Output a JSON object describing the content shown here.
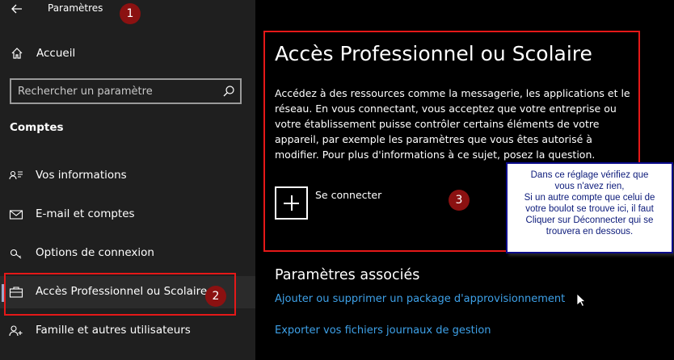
{
  "window": {
    "title": "Paramètres",
    "back_icon": "arrow-left-icon"
  },
  "sidebar": {
    "home_label": "Accueil",
    "search_placeholder": "Rechercher un paramètre",
    "section_title": "Comptes",
    "items": [
      {
        "label": "Vos informations",
        "icon": "person-card-icon"
      },
      {
        "label": "E-mail et comptes",
        "icon": "mail-icon"
      },
      {
        "label": "Options de connexion",
        "icon": "key-icon"
      },
      {
        "label": "Accès Professionnel ou Scolaire",
        "icon": "briefcase-icon",
        "selected": true
      },
      {
        "label": "Famille et autres utilisateurs",
        "icon": "person-add-icon"
      }
    ]
  },
  "main": {
    "title": "Accès Professionnel ou Scolaire",
    "description": "Accédez à des ressources comme la messagerie, les applications et le réseau. En vous connectant, vous acceptez que votre entreprise ou votre établissement puisse contrôler certains éléments de votre appareil, par exemple les paramètres que vous êtes autorisé à modifier. Pour plus d'informations à ce sujet, posez la question.",
    "connect_label": "Se connecter",
    "related_title": "Paramètres associés",
    "links": [
      "Ajouter ou supprimer un package d'approvisionnement",
      "Exporter vos fichiers journaux de gestion"
    ]
  },
  "annotations": {
    "markers": [
      "1",
      "2",
      "3"
    ],
    "tooltip_lines": [
      "Dans ce réglage vérifiez que",
      "vous n'avez rien,",
      "Si un autre compte que celui de",
      "votre boulot se trouve ici, il faut",
      "Cliquer sur Déconnecter qui se",
      "trouvera en dessous."
    ]
  },
  "colors": {
    "link": "#3ea1e8",
    "marker": "#8b1111",
    "highlight_box": "#e51818",
    "tooltip_text": "#0b1a7a"
  }
}
